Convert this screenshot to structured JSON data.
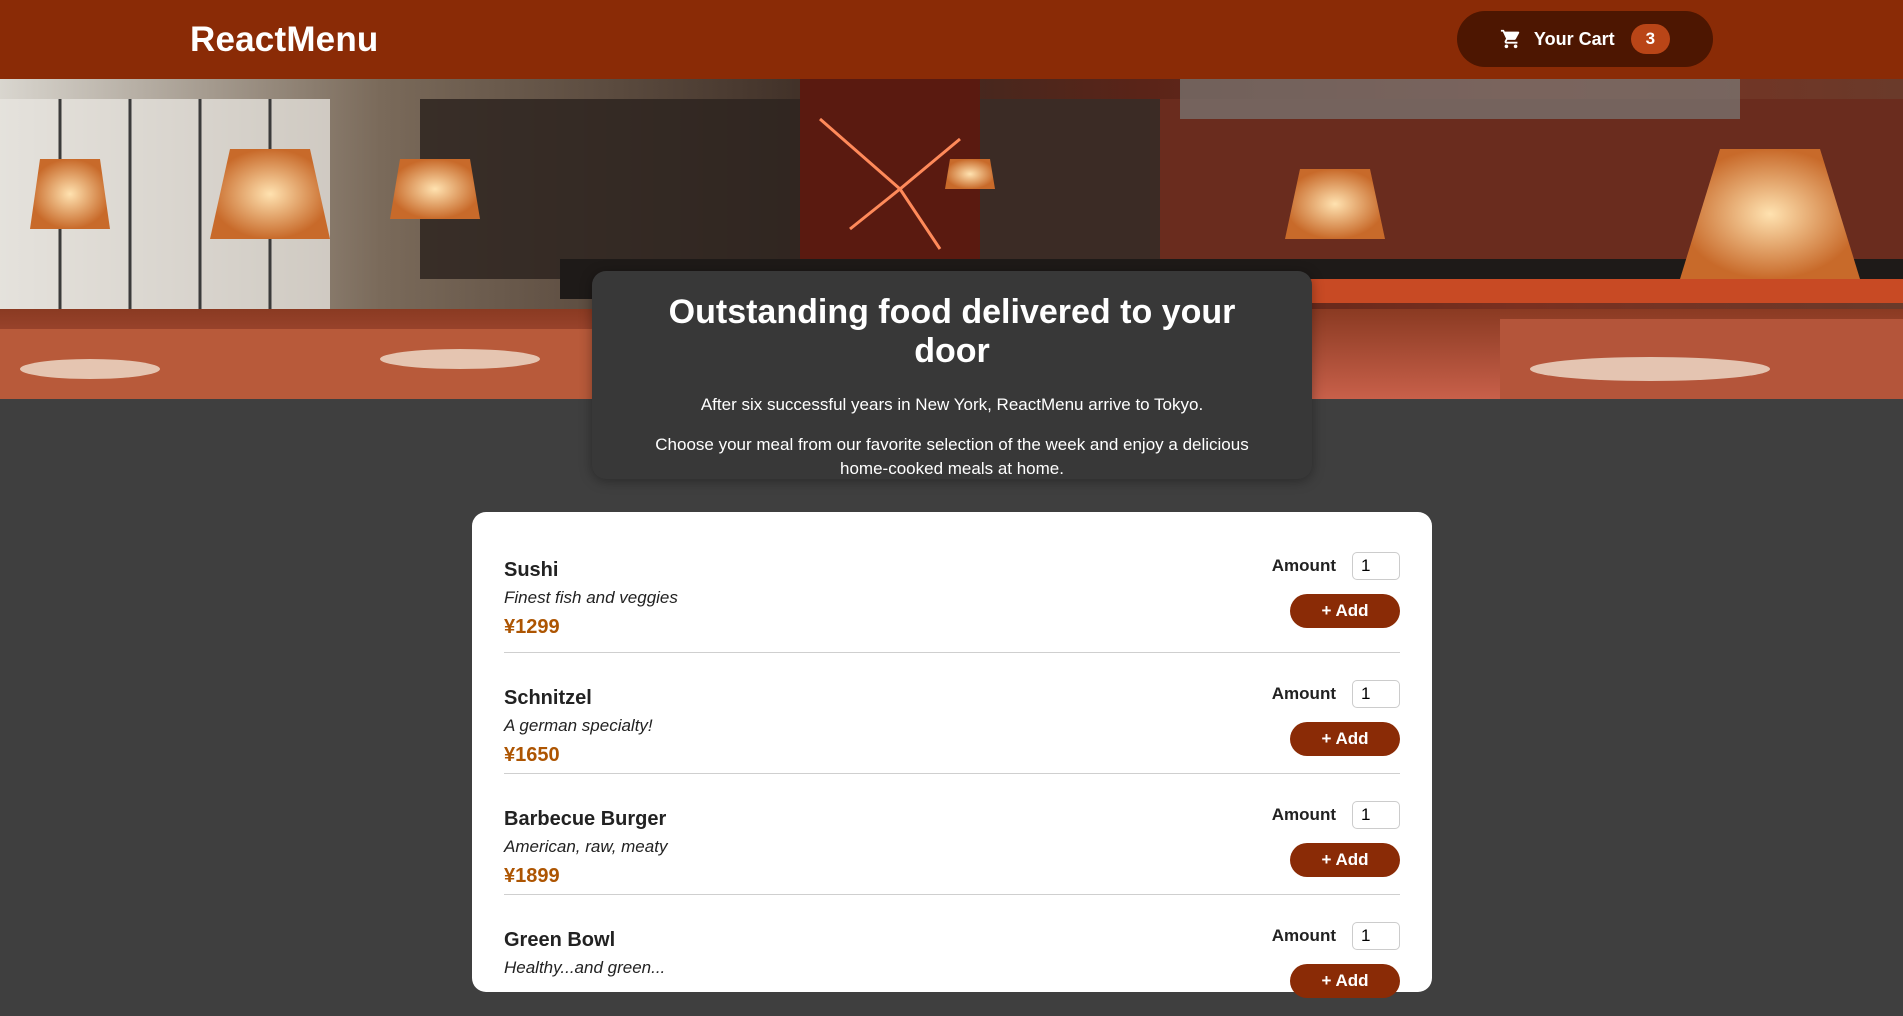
{
  "header": {
    "brand": "ReactMenu",
    "cart": {
      "label": "Your Cart",
      "count": "3",
      "icon": "cart-icon"
    }
  },
  "hero": {
    "image": "restaurant interior"
  },
  "summary": {
    "title": "Outstanding food delivered to your door",
    "paragraph1": "After six successful years in New York, ReactMenu arrive to Tokyo.",
    "paragraph2": "Choose your meal from our favorite selection of the week and enjoy a delicious home-cooked meals at home."
  },
  "meals": [
    {
      "name": "Sushi",
      "description": "Finest fish and veggies",
      "price": "¥1299",
      "amount_label": "Amount",
      "amount": "1",
      "add_label": "+ Add"
    },
    {
      "name": "Schnitzel",
      "description": "A german specialty!",
      "price": "¥1650",
      "amount_label": "Amount",
      "amount": "1",
      "add_label": "+ Add"
    },
    {
      "name": "Barbecue Burger",
      "description": "American, raw, meaty",
      "price": "¥1899",
      "amount_label": "Amount",
      "amount": "1",
      "add_label": "+ Add"
    },
    {
      "name": "Green Bowl",
      "description": "Healthy...and green...",
      "price": "",
      "amount_label": "Amount",
      "amount": "1",
      "add_label": "+ Add"
    }
  ],
  "colors": {
    "header": "#8a2b06",
    "cart_button": "#4d1601",
    "badge": "#b94517",
    "price": "#ad5502",
    "background": "#3f3f3f"
  }
}
